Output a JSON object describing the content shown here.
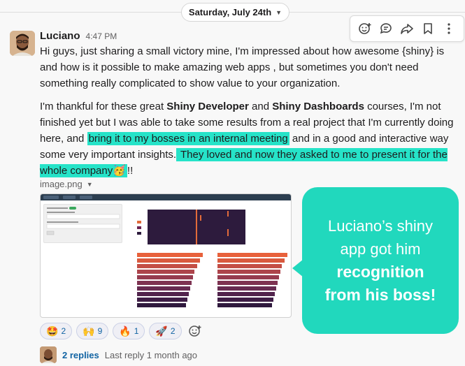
{
  "date_divider": {
    "label": "Saturday, July 24th"
  },
  "message": {
    "author": "Luciano",
    "time": "4:47 PM",
    "p1": "Hi guys, just sharing a small victory mine, I'm impressed about how awesome {shiny} is and how is it possible to make amazing web apps , but sometimes you don't need something really complicated to show value to your organization.",
    "p2": {
      "t1": "I'm thankful for these great ",
      "b1": "Shiny Developer",
      "t2": " and ",
      "b2": "Shiny Dashboards",
      "t3": " courses, I'm not finished yet but I was able to take some results from a real project that I'm currently doing here, and ",
      "h1": "bring it to my bosses in an internal meeting",
      "t4": " and in a good and interactive way some very important insights.",
      "h2": " They loved and now they asked to me to present it for the whole company",
      "emoji": "🥳",
      "t5": "!!"
    }
  },
  "attachment": {
    "name": "image.png"
  },
  "badge": {
    "line1": "Luciano’s shiny",
    "line2": "app got him",
    "line3": "recognition",
    "line4": "from his boss!"
  },
  "reactions": [
    {
      "emoji": "🤩",
      "count": "2"
    },
    {
      "emoji": "🙌",
      "count": "9"
    },
    {
      "emoji": "🔥",
      "count": "1"
    },
    {
      "emoji": "🚀",
      "count": "2"
    }
  ],
  "thread": {
    "replies": "2 replies",
    "last": "Last reply 1 month ago"
  },
  "colors": {
    "highlight": "#26e3c8",
    "badge": "#21d8bd",
    "link": "#1264a3"
  }
}
